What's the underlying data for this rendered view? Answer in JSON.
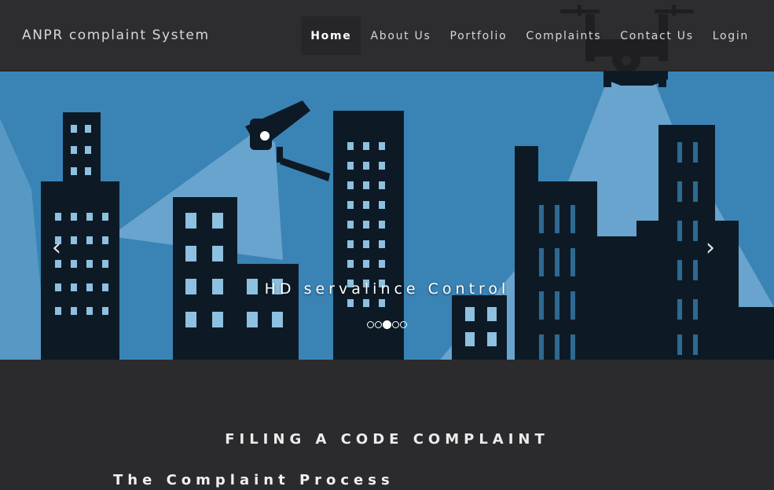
{
  "navbar": {
    "brand": "ANPR complaint System",
    "items": [
      {
        "label": "Home",
        "active": true
      },
      {
        "label": "About Us",
        "active": false
      },
      {
        "label": "Portfolio",
        "active": false
      },
      {
        "label": "Complaints",
        "active": false
      },
      {
        "label": "Contact Us",
        "active": false
      },
      {
        "label": "Login",
        "active": false
      }
    ]
  },
  "carousel": {
    "caption": "HD servalince Control",
    "prev_icon": "chevron-left-icon",
    "next_icon": "chevron-right-icon",
    "prev_glyph": "‹",
    "next_glyph": "›",
    "slide_count": 5,
    "active_slide": 3
  },
  "content": {
    "title": "FILING A CODE COMPLAINT",
    "subtitle": "The Complaint Process"
  },
  "colors": {
    "navbar_bg": "#2d2d30",
    "sky": "#3a84b5",
    "building": "#0d1a26",
    "light_beam": "#8ec0e0",
    "content_bg": "#2b2b2d"
  }
}
